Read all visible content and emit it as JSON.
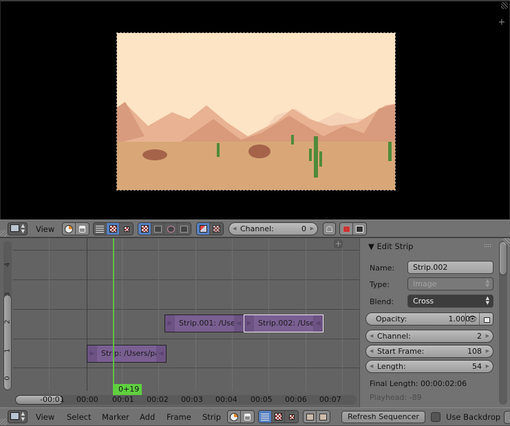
{
  "preview": {
    "plus_label": "+",
    "scene": {
      "sky_color": "#fde4c4",
      "ground_color": "#d9a777",
      "mountain_colors": [
        "#d99b7d",
        "#e8b293",
        "#f0c8ac"
      ],
      "cactus_color": "#4f8a3a",
      "rock_color": "#a5634a"
    }
  },
  "preview_header": {
    "menu": [
      {
        "label": "View"
      }
    ],
    "channel_field": {
      "label": "Channel:",
      "value": "0"
    },
    "icons": [
      "editor-type-icon",
      "clock-icon",
      "lock-icon",
      "sequencer-view-icon",
      "preview-view-icon",
      "sequencer-preview-view-icon",
      "image-preview-icon",
      "luma-waveform-icon",
      "chroma-vectorscope-icon",
      "histogram-icon",
      "overlay-icon",
      "backdrop-icon",
      "ghost-icon",
      "render-image-icon",
      "clapboard-icon"
    ]
  },
  "timeline": {
    "channels": [
      "0",
      "1",
      "2",
      "3",
      "4"
    ],
    "ticks": [
      "-00:01",
      "00:00",
      "00:01",
      "00:02",
      "00:03",
      "00:04",
      "00:05",
      "00:06",
      "00:07"
    ],
    "playhead_label": "0+19",
    "strips": [
      {
        "label": "Strip: /Users/pa",
        "channel": 1,
        "selected": false
      },
      {
        "label": "Strip.001: /Use",
        "channel": 2,
        "selected": false
      },
      {
        "label": "Strip.002: /Use",
        "channel": 2,
        "selected": true
      }
    ],
    "playhead_color": "#60c040",
    "strip_color": "#7a5f92"
  },
  "edit_strip": {
    "title": "Edit Strip",
    "name_label": "Name:",
    "name_value": "Strip.002",
    "type_label": "Type:",
    "type_value": "Image",
    "blend_label": "Blend:",
    "blend_value": "Cross",
    "opacity_label": "Opacity:",
    "opacity_value": "1.000",
    "channel_label": "Channel:",
    "channel_value": "2",
    "start_frame_label": "Start Frame:",
    "start_frame_value": "108",
    "length_label": "Length:",
    "length_value": "54",
    "final_length": "Final Length: 00:00:02:06",
    "playhead": "Playhead: -89"
  },
  "bottom_header": {
    "menu": [
      {
        "label": "View"
      },
      {
        "label": "Select"
      },
      {
        "label": "Marker"
      },
      {
        "label": "Add"
      },
      {
        "label": "Frame"
      },
      {
        "label": "Strip"
      }
    ],
    "refresh_label": "Refresh Sequencer",
    "use_backdrop_label": "Use Backdrop",
    "use_backdrop_checked": false
  },
  "accent_color": "#5680c2"
}
